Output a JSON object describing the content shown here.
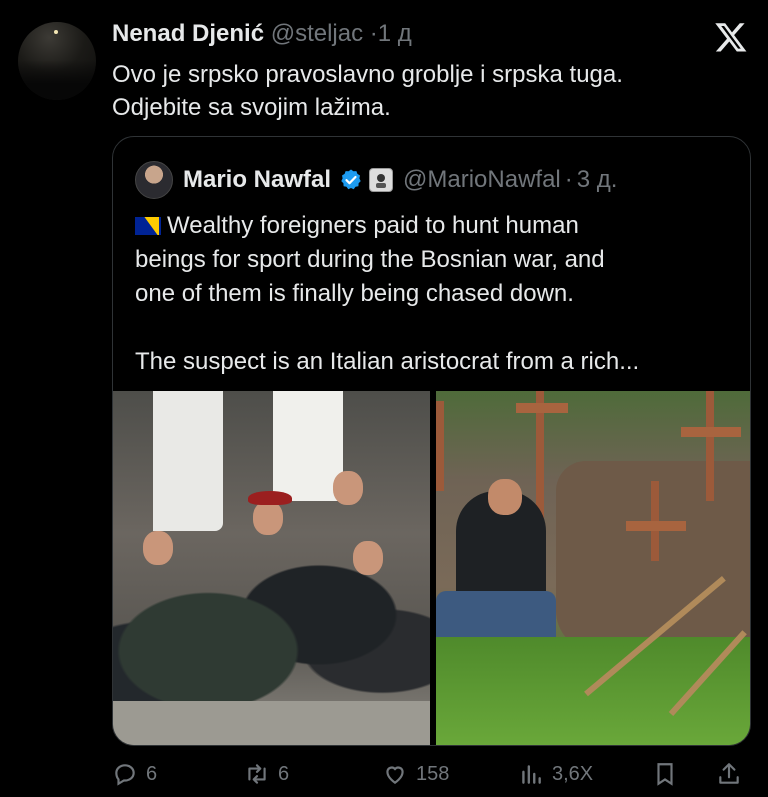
{
  "post": {
    "author_name": "Nenad Djenić",
    "author_handle": "@steljac",
    "separator": "·",
    "time": "1 д",
    "text_lines": [
      "Ovo je srpsko pravoslavno groblje i srpska tuga.",
      "Odjebite sa svojim lažima."
    ]
  },
  "quote": {
    "author_name": "Mario Nawfal",
    "author_handle": "@MarioNawfal",
    "separator": "·",
    "time": "3 д.",
    "text_lines": [
      "Wealthy foreigners paid to hunt human",
      "beings for sport during the Bosnian war, and",
      "one of them is finally being chased down.",
      "",
      "The suspect is an Italian aristocrat from a rich..."
    ]
  },
  "actions": {
    "replies": "6",
    "reposts": "6",
    "likes": "158",
    "views": "3,6X"
  },
  "colors": {
    "background": "#000000",
    "text": "#e7e9ea",
    "muted": "#71767b",
    "border": "#2f3336",
    "verified": "#1d9bf0"
  },
  "icons": [
    "x-logo-icon",
    "verified-badge-icon",
    "affiliate-badge-icon",
    "bosnia-flag-icon",
    "reply-icon",
    "repost-icon",
    "like-icon",
    "views-icon",
    "bookmark-icon",
    "share-icon"
  ]
}
